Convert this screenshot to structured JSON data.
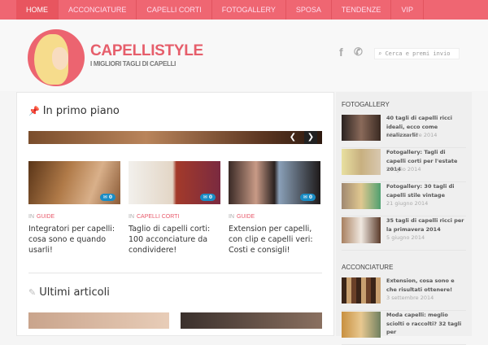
{
  "nav": {
    "items": [
      "HOME",
      "ACCONCIATURE",
      "CAPELLI CORTI",
      "FOTOGALLERY",
      "SPOSA",
      "TENDENZE",
      "VIP"
    ]
  },
  "header": {
    "title": "CAPELLISTYLE",
    "tagline": "I MIGLIORI TAGLI DI CAPELLI",
    "search_placeholder": "Cerca e premi invio",
    "facebook": "f",
    "phone": "✆"
  },
  "main": {
    "featured_title": "In primo piano",
    "cards": [
      {
        "in": "IN",
        "category": "GUIDE",
        "title": "Integratori per capelli: cosa sono e quando usarli!",
        "comments": "0"
      },
      {
        "in": "IN",
        "category": "CAPELLI CORTI",
        "title": "Taglio di capelli corti: 100 acconciature da condividere!",
        "comments": "0"
      },
      {
        "in": "IN",
        "category": "GUIDE",
        "title": "Extension per capelli, con clip e capelli veri: Costi e consigli!",
        "comments": "0"
      }
    ],
    "latest_title": "Ultimi articoli"
  },
  "sidebar": {
    "fotogallery_title": "FOTOGALLERY",
    "fotogallery": [
      {
        "title": "40 tagli di capelli ricci ideali, ecco come realizzarli!",
        "date": "19 settembre 2014"
      },
      {
        "title": "Fotogallery: Tagli di capelli corti per l'estate 2014",
        "date": "5 luglio 2014"
      },
      {
        "title": "Fotogallery: 30 tagli di capelli stile vintage",
        "date": "21 giugno 2014"
      },
      {
        "title": "35 tagli di capelli ricci per la primavera 2014",
        "date": "5 giugno 2014"
      }
    ],
    "acconciature_title": "ACCONCIATURE",
    "acconciature": [
      {
        "title": "Extension, cosa sono e che risultati ottenere!",
        "date": "3 settembre 2014"
      },
      {
        "title": "Moda capelli: meglio sciolti o raccolti? 32 tagli per",
        "date": ""
      }
    ]
  }
}
